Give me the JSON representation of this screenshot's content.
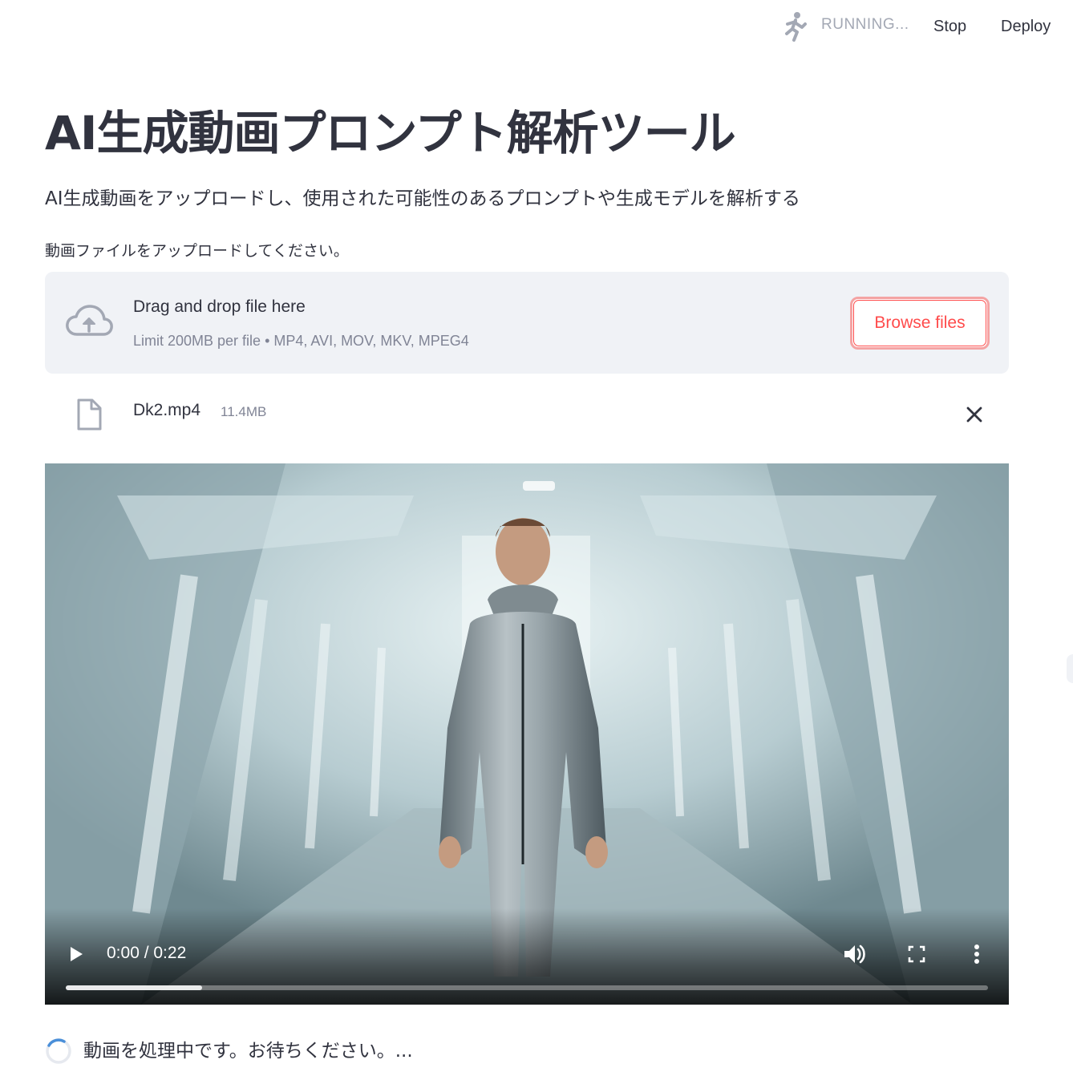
{
  "toolbar": {
    "status": "RUNNING...",
    "stop_label": "Stop",
    "deploy_label": "Deploy"
  },
  "page": {
    "title": "AI生成動画プロンプト解析ツール",
    "subtitle": "AI生成動画をアップロードし、使用された可能性のあるプロンプトや生成モデルを解析する"
  },
  "uploader": {
    "label": "動画ファイルをアップロードしてください。",
    "drop_title": "Drag and drop file here",
    "limit_text": "Limit 200MB per file • MP4, AVI, MOV, MKV, MPEG4",
    "browse_label": "Browse files",
    "file": {
      "name": "Dk2.mp4",
      "size": "11.4MB"
    }
  },
  "video": {
    "time": "0:00 / 0:22",
    "buffered_fraction": 0.148
  },
  "status": {
    "processing_text": "動画を処理中です。お待ちください。..."
  },
  "colors": {
    "accent": "#ff4b4b",
    "text": "#31333f",
    "muted": "#808495",
    "panel": "#f0f2f6"
  },
  "icons": {
    "running": "running-man-icon",
    "upload": "cloud-upload-icon",
    "file": "file-icon",
    "close": "close-icon",
    "play": "play-icon",
    "volume": "volume-icon",
    "fullscreen": "fullscreen-icon",
    "more": "more-vertical-icon",
    "spinner": "spinner-icon"
  }
}
